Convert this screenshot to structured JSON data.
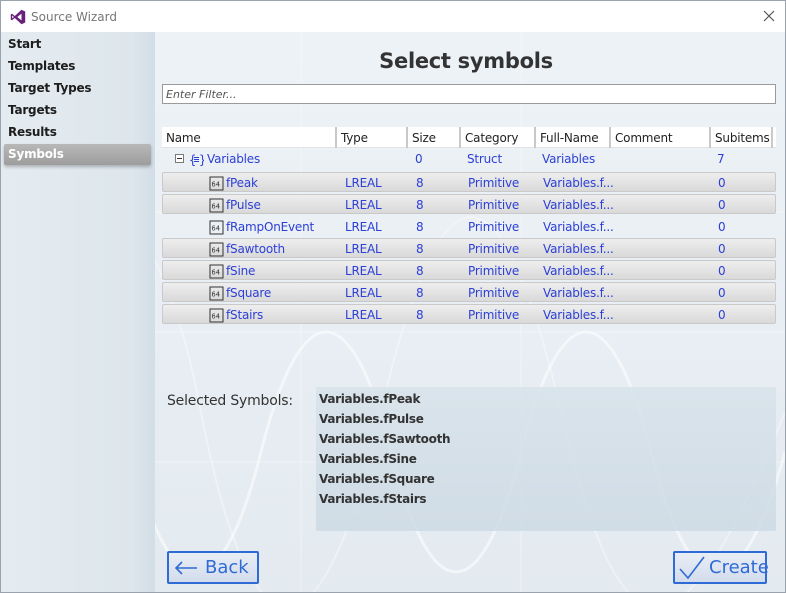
{
  "window": {
    "title": "Source Wizard"
  },
  "sidebar": {
    "items": [
      {
        "label": "Start",
        "active": false
      },
      {
        "label": "Templates",
        "active": false
      },
      {
        "label": "Target Types",
        "active": false
      },
      {
        "label": "Targets",
        "active": false
      },
      {
        "label": "Results",
        "active": false
      },
      {
        "label": "Symbols",
        "active": true
      }
    ]
  },
  "main": {
    "title": "Select symbols",
    "filter": {
      "value": "",
      "placeholder": "Enter Filter..."
    },
    "grid": {
      "columns": [
        "Name",
        "Type",
        "Size",
        "Category",
        "Full-Name",
        "Comment",
        "Subitems"
      ],
      "root": {
        "name": "Variables",
        "type": "",
        "size": "0",
        "category": "Struct",
        "full_name": "Variables",
        "comment": "",
        "subitems": "7",
        "expanded": true
      },
      "rows": [
        {
          "name": "fPeak",
          "type": "LREAL",
          "size": "8",
          "category": "Primitive",
          "full_name": "Variables.f...",
          "comment": "",
          "subitems": "0",
          "selected": true
        },
        {
          "name": "fPulse",
          "type": "LREAL",
          "size": "8",
          "category": "Primitive",
          "full_name": "Variables.f...",
          "comment": "",
          "subitems": "0",
          "selected": true
        },
        {
          "name": "fRampOnEvent",
          "type": "LREAL",
          "size": "8",
          "category": "Primitive",
          "full_name": "Variables.f...",
          "comment": "",
          "subitems": "0",
          "selected": false
        },
        {
          "name": "fSawtooth",
          "type": "LREAL",
          "size": "8",
          "category": "Primitive",
          "full_name": "Variables.f...",
          "comment": "",
          "subitems": "0",
          "selected": true
        },
        {
          "name": "fSine",
          "type": "LREAL",
          "size": "8",
          "category": "Primitive",
          "full_name": "Variables.f...",
          "comment": "",
          "subitems": "0",
          "selected": true
        },
        {
          "name": "fSquare",
          "type": "LREAL",
          "size": "8",
          "category": "Primitive",
          "full_name": "Variables.f...",
          "comment": "",
          "subitems": "0",
          "selected": true
        },
        {
          "name": "fStairs",
          "type": "LREAL",
          "size": "8",
          "category": "Primitive",
          "full_name": "Variables.f...",
          "comment": "",
          "subitems": "0",
          "selected": true
        }
      ]
    },
    "selected_symbols": {
      "label": "Selected Symbols:",
      "items": [
        "Variables.fPeak",
        "Variables.fPulse",
        "Variables.fSawtooth",
        "Variables.fSine",
        "Variables.fSquare",
        "Variables.fStairs"
      ]
    },
    "buttons": {
      "back": "Back",
      "create": "Create"
    }
  },
  "colors": {
    "accent": "#2e6bd4",
    "link_text": "#2c3fd6",
    "selected_row": "#dcdcdc"
  },
  "icons": {
    "app": "visual-studio-icon",
    "close": "close-icon",
    "struct": "struct-icon",
    "variable": "lreal-variable-icon",
    "back": "arrow-left-icon",
    "create": "checkmark-icon"
  }
}
